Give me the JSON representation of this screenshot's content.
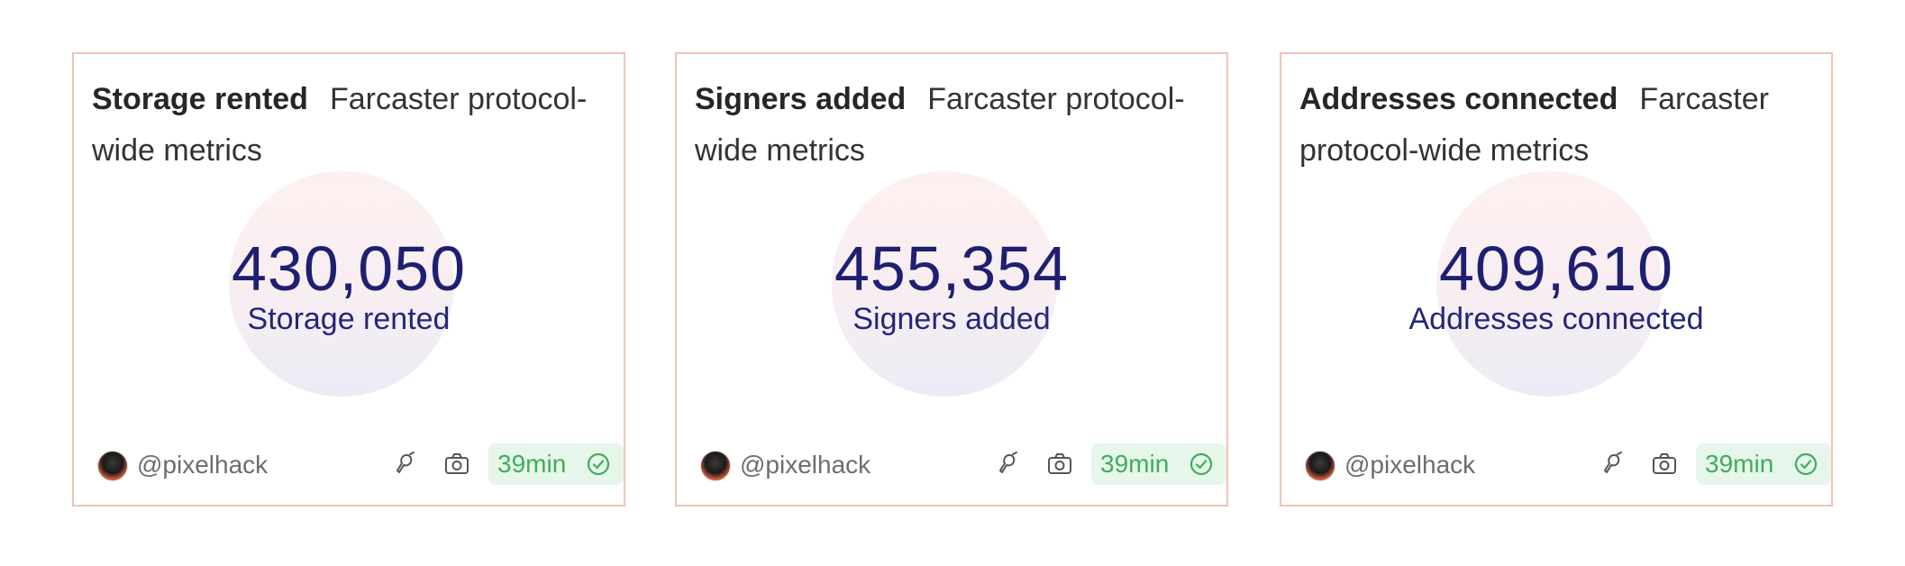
{
  "colors": {
    "card_border": "#efc4b5",
    "metric_text": "#1f1f72",
    "badge_bg": "#e6f6ea",
    "badge_text": "#3fae5b"
  },
  "cards": [
    {
      "title": "Storage rented",
      "description": "Farcaster protocol-wide metrics",
      "value": "430,050",
      "label": "Storage rented",
      "author": "@pixelhack",
      "time": "39min",
      "icons": [
        "mic-icon",
        "camera-icon",
        "check-circle-icon"
      ]
    },
    {
      "title": "Signers added",
      "description": "Farcaster protocol-wide metrics",
      "value": "455,354",
      "label": "Signers added",
      "author": "@pixelhack",
      "time": "39min",
      "icons": [
        "mic-icon",
        "camera-icon",
        "check-circle-icon"
      ]
    },
    {
      "title": "Addresses connected",
      "description": "Farcaster protocol-wide metrics",
      "value": "409,610",
      "label": "Addresses connected",
      "author": "@pixelhack",
      "time": "39min",
      "icons": [
        "mic-icon",
        "camera-icon",
        "check-circle-icon"
      ]
    }
  ]
}
